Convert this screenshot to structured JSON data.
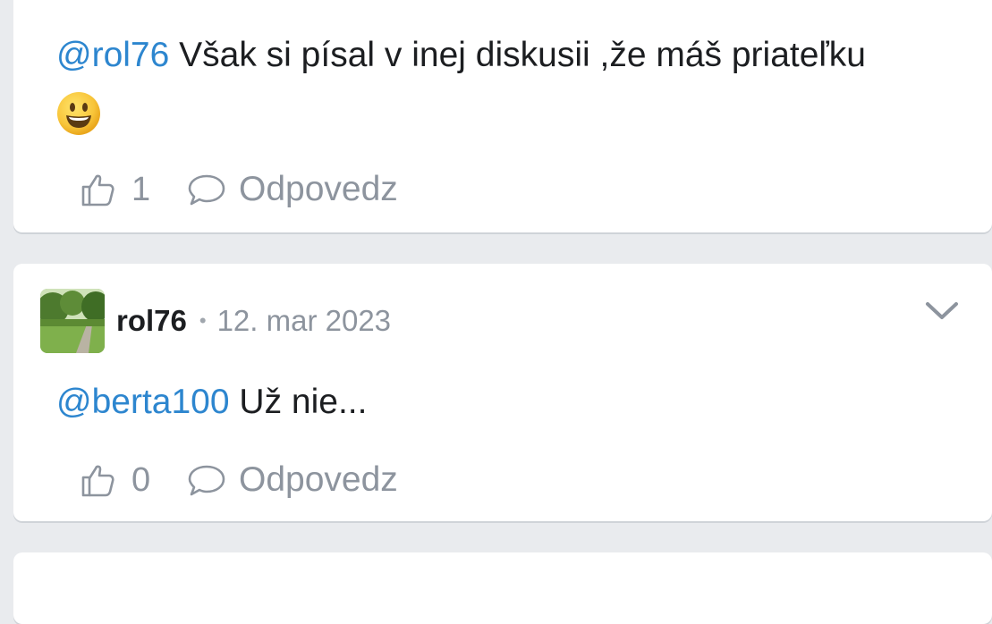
{
  "comments": [
    {
      "mention": "@rol76",
      "text": " Však si písal v inej diskusii ,že máš priateľku",
      "emoji": "smiling-face-emoji",
      "likes": "1",
      "reply_label": "Odpovedz"
    },
    {
      "author": "rol76",
      "separator": "•",
      "timestamp": "12. mar 2023",
      "mention": "@berta100",
      "text": " Už nie...",
      "likes": "0",
      "reply_label": "Odpovedz"
    }
  ],
  "colors": {
    "mention": "#2d86cf",
    "muted": "#8d949e",
    "background": "#e9ebee"
  }
}
